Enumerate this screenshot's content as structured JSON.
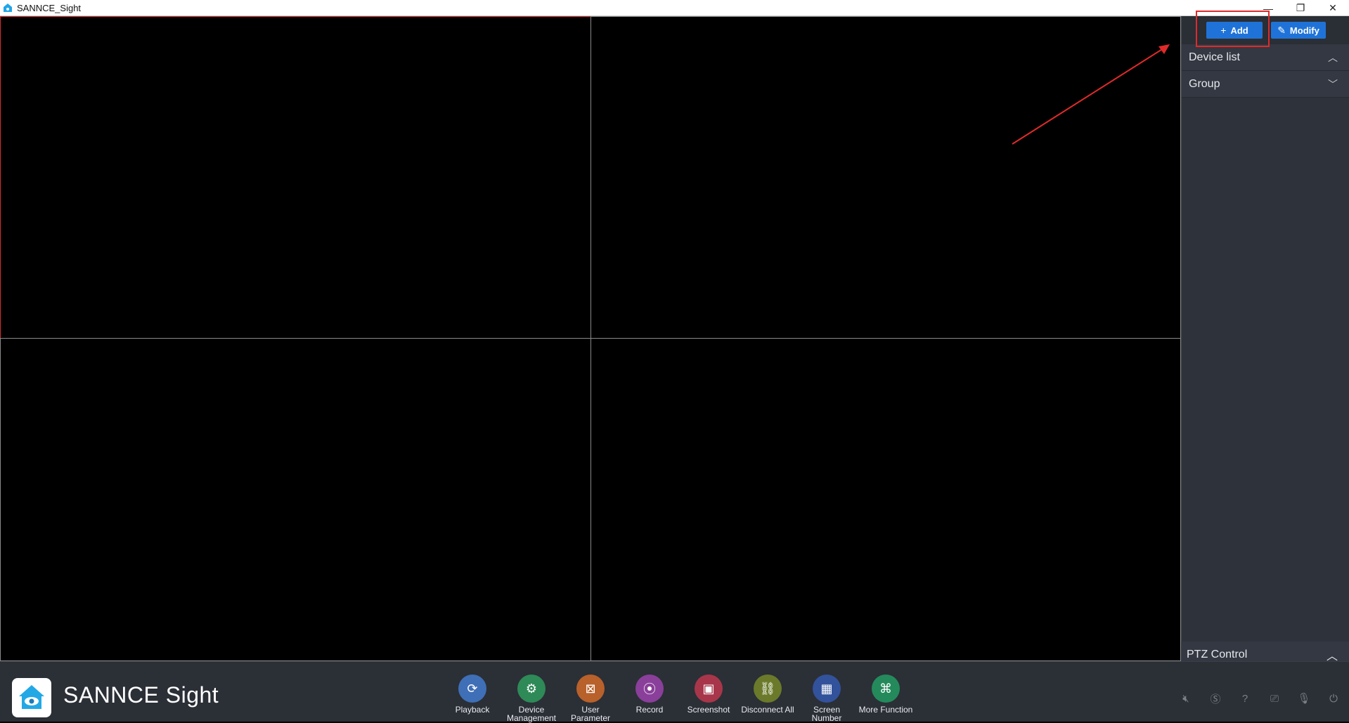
{
  "window": {
    "title": "SANNCE_Sight",
    "minimize_glyph": "—",
    "maximize_glyph": "❐",
    "close_glyph": "✕"
  },
  "right_panel": {
    "add_label": "Add",
    "modify_label": "Modify",
    "sections": [
      {
        "label": "Device list",
        "chevron": "︿"
      },
      {
        "label": "Group",
        "chevron": "﹀"
      }
    ],
    "ptz_label": "PTZ Control",
    "ptz_chevron": "︿"
  },
  "bottom": {
    "brand": "SANNCE Sight",
    "functions": [
      {
        "label": "Playback",
        "icon": "playback-icon",
        "color": "#3f6fb6",
        "glyph": "⟳"
      },
      {
        "label": "Device Management",
        "icon": "device-management-icon",
        "color": "#2e8a57",
        "glyph": "⚙"
      },
      {
        "label": "User Parameter",
        "icon": "user-parameter-icon",
        "color": "#b8612a",
        "glyph": "⊠"
      },
      {
        "label": "Record",
        "icon": "record-icon",
        "color": "#8a3f9a",
        "glyph": "⦿"
      },
      {
        "label": "Screenshot",
        "icon": "screenshot-icon",
        "color": "#a8364a",
        "glyph": "▣"
      },
      {
        "label": "Disconnect All",
        "icon": "disconnect-icon",
        "color": "#6a7a2a",
        "glyph": "⛓"
      },
      {
        "label": "Screen Number",
        "icon": "screen-number-icon",
        "color": "#33529c",
        "glyph": "▦"
      },
      {
        "label": "More Function",
        "icon": "more-function-icon",
        "color": "#248a5c",
        "glyph": "⌘"
      }
    ],
    "status_icons": [
      "mute-icon",
      "sd-icon",
      "help-icon",
      "camera-icon",
      "microphone-icon",
      "power-icon"
    ]
  },
  "colors": {
    "accent": "#1f73d8",
    "annotation": "#e02a2a",
    "active_cell_border": "#e02a2a"
  }
}
